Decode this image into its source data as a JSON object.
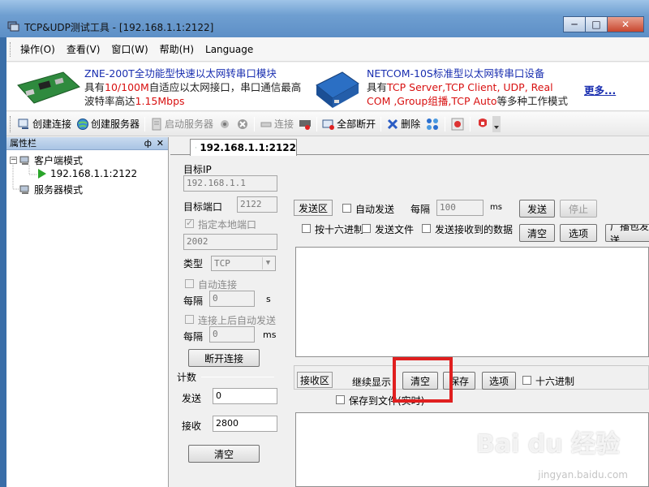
{
  "window": {
    "title": "TCP&UDP测试工具 - [192.168.1.1:2122]",
    "min": "─",
    "max": "□",
    "close": "✕"
  },
  "menu": [
    "操作(O)",
    "查看(V)",
    "窗口(W)",
    "帮助(H)",
    "Language"
  ],
  "banner": {
    "ad1_title": "ZNE-200T全功能型快速以太网转串口模块",
    "ad1_line1_a": "具有",
    "ad1_line1_red": "10/100M",
    "ad1_line1_b": "自适应以太网接口，串口通信最高",
    "ad1_line2_a": "波特率高达",
    "ad1_line2_red": "1.15Mbps",
    "ad2_title": "NETCOM-10S标准型以太网转串口设备",
    "ad2_line1_a": "具有",
    "ad2_line1_red": "TCP Server,TCP Client, UDP, Real",
    "ad2_line2_red": "COM ,Group组播,TCP Auto",
    "ad2_line2_b": "等多种工作模式",
    "more": "更多..."
  },
  "toolbar": {
    "create_conn": "创建连接",
    "create_server": "创建服务器",
    "start_server": "启动服务器",
    "connect": "连接",
    "disconnect_all": "全部断开",
    "delete": "删除"
  },
  "left_panel": {
    "title": "属性栏",
    "pin": "ф",
    "close": "✕",
    "client_mode": "客户端模式",
    "client_item": "192.168.1.1:2122",
    "server_mode": "服务器模式"
  },
  "tab": {
    "label": "192.168.1.1:2122"
  },
  "conn": {
    "target_ip_label": "目标IP",
    "target_ip": "192.168.1.1",
    "target_port_label": "目标端口",
    "target_port": "2122",
    "local_port_label": "指定本地端口",
    "local_port": "2002",
    "type_label": "类型",
    "type_value": "TCP",
    "auto_connect_label": "自动连接",
    "interval1_label": "每隔",
    "interval1_value": "0",
    "interval1_unit": "s",
    "auto_send_label": "连接上后自动发送",
    "interval2_label": "每隔",
    "interval2_value": "0",
    "interval2_unit": "ms",
    "disconnect_btn": "断开连接",
    "count_label": "计数",
    "send_label": "发送",
    "send_count": "0",
    "recv_label": "接收",
    "recv_count": "2800",
    "clear_btn": "清空"
  },
  "send_area": {
    "title": "发送区",
    "auto_send": "自动发送",
    "interval_label": "每隔",
    "interval_value": "100",
    "interval_unit": "ms",
    "send_btn": "发送",
    "stop_btn": "停止",
    "hex_input": "按十六进制",
    "send_file": "发送文件",
    "send_received": "发送接收到的数据",
    "clear_btn": "清空",
    "options_btn": "选项",
    "broadcast_btn": "广播包发送"
  },
  "recv_area": {
    "title": "接收区",
    "continue_display": "继续显示",
    "clear_btn": "清空",
    "save_btn": "保存",
    "options_btn": "选项",
    "hex": "十六进制",
    "save_to_file": "保存到文件(实时)"
  },
  "watermark": {
    "main": "Bai du 经验",
    "sub": "jingyan.baidu.com"
  },
  "colors": {
    "highlight": "#e01f1f",
    "link": "#1a2fb0",
    "accent_red": "#d81010"
  }
}
